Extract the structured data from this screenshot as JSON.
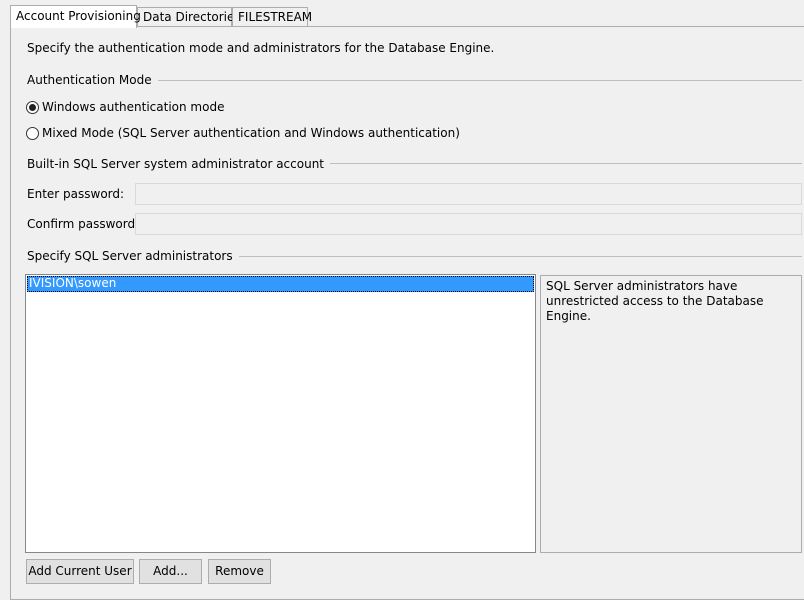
{
  "tabs": [
    {
      "label": "Account Provisioning",
      "active": true
    },
    {
      "label": "Data Directories",
      "active": false
    },
    {
      "label": "FILESTREAM",
      "active": false
    }
  ],
  "intro_text": "Specify the authentication mode and administrators for the Database Engine.",
  "auth_mode": {
    "group_label": "Authentication Mode",
    "options": [
      {
        "label": "Windows authentication mode",
        "selected": true
      },
      {
        "label": "Mixed Mode (SQL Server authentication and Windows authentication)",
        "selected": false
      }
    ]
  },
  "sa_account": {
    "group_label": "Built-in SQL Server system administrator account",
    "password_label": "Enter password:",
    "password_value": "",
    "confirm_label": "Confirm password:",
    "confirm_value": ""
  },
  "admins": {
    "group_label": "Specify SQL Server administrators",
    "items": [
      "IVISION\\sowen"
    ],
    "info_text": "SQL Server administrators have unrestricted access to the Database Engine.",
    "buttons": {
      "add_current": "Add Current User",
      "add": "Add...",
      "remove": "Remove"
    }
  },
  "colors": {
    "selection": "#3399ff",
    "background": "#f0f0f0"
  }
}
